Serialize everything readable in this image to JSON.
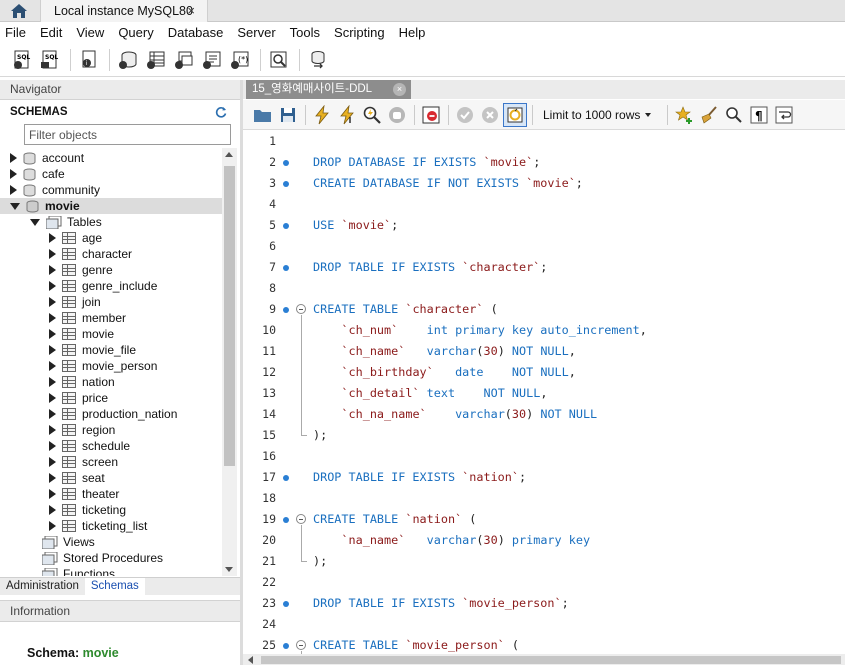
{
  "window": {
    "connection_tab": "Local instance MySQL80",
    "close_glyph": "×"
  },
  "menu": [
    "File",
    "Edit",
    "View",
    "Query",
    "Database",
    "Server",
    "Tools",
    "Scripting",
    "Help"
  ],
  "navigator": {
    "header": "Navigator",
    "schemas_title": "SCHEMAS",
    "filter_placeholder": "Filter objects",
    "schemas": [
      "account",
      "cafe",
      "community"
    ],
    "selected_schema": "movie",
    "tables_label": "Tables",
    "tables": [
      "age",
      "character",
      "genre",
      "genre_include",
      "join",
      "member",
      "movie",
      "movie_file",
      "movie_person",
      "nation",
      "price",
      "production_nation",
      "region",
      "schedule",
      "screen",
      "seat",
      "theater",
      "ticketing",
      "ticketing_list"
    ],
    "folders": [
      "Views",
      "Stored Procedures",
      "Functions"
    ],
    "tabs": [
      "Administration",
      "Schemas"
    ],
    "active_tab": "Schemas"
  },
  "information": {
    "header": "Information",
    "schema_label": "Schema:",
    "schema_value": "movie"
  },
  "editor": {
    "tab_title": "15_영화예매사이트-DDL",
    "limit_label": "Limit to 1000 rows",
    "lines": [
      {
        "n": "1",
        "dot": false,
        "fold": false,
        "tokens": []
      },
      {
        "n": "2",
        "dot": true,
        "fold": false,
        "tokens": [
          [
            "kw",
            "DROP DATABASE IF EXISTS "
          ],
          [
            "id",
            "`movie`"
          ],
          [
            "txt",
            ";"
          ]
        ]
      },
      {
        "n": "3",
        "dot": true,
        "fold": false,
        "tokens": [
          [
            "kw",
            "CREATE DATABASE IF NOT EXISTS "
          ],
          [
            "id",
            "`movie`"
          ],
          [
            "txt",
            ";"
          ]
        ]
      },
      {
        "n": "4",
        "dot": false,
        "fold": false,
        "tokens": []
      },
      {
        "n": "5",
        "dot": true,
        "fold": false,
        "tokens": [
          [
            "kw",
            "USE "
          ],
          [
            "id",
            "`movie`"
          ],
          [
            "txt",
            ";"
          ]
        ]
      },
      {
        "n": "6",
        "dot": false,
        "fold": false,
        "tokens": []
      },
      {
        "n": "7",
        "dot": true,
        "fold": false,
        "tokens": [
          [
            "kw",
            "DROP TABLE IF EXISTS "
          ],
          [
            "id",
            "`character`"
          ],
          [
            "txt",
            ";"
          ]
        ]
      },
      {
        "n": "8",
        "dot": false,
        "fold": false,
        "tokens": []
      },
      {
        "n": "9",
        "dot": true,
        "fold": true,
        "tokens": [
          [
            "kw",
            "CREATE TABLE "
          ],
          [
            "id",
            "`character`"
          ],
          [
            "txt",
            " ("
          ]
        ]
      },
      {
        "n": "10",
        "dot": false,
        "fold": false,
        "tokens": [
          [
            "txt",
            "    "
          ],
          [
            "id",
            "`ch_num`"
          ],
          [
            "txt",
            "    "
          ],
          [
            "kw",
            "int primary key auto_increment"
          ],
          [
            "txt",
            ","
          ]
        ]
      },
      {
        "n": "11",
        "dot": false,
        "fold": false,
        "tokens": [
          [
            "txt",
            "    "
          ],
          [
            "id",
            "`ch_name`"
          ],
          [
            "txt",
            "   "
          ],
          [
            "kw",
            "varchar"
          ],
          [
            "txt",
            "("
          ],
          [
            "num",
            "30"
          ],
          [
            "txt",
            ") "
          ],
          [
            "kw",
            "NOT NULL"
          ],
          [
            "txt",
            ","
          ]
        ]
      },
      {
        "n": "12",
        "dot": false,
        "fold": false,
        "tokens": [
          [
            "txt",
            "    "
          ],
          [
            "id",
            "`ch_birthday`"
          ],
          [
            "txt",
            "   "
          ],
          [
            "kw",
            "date"
          ],
          [
            "txt",
            "    "
          ],
          [
            "kw",
            "NOT NULL"
          ],
          [
            "txt",
            ","
          ]
        ]
      },
      {
        "n": "13",
        "dot": false,
        "fold": false,
        "tokens": [
          [
            "txt",
            "    "
          ],
          [
            "id",
            "`ch_detail`"
          ],
          [
            "txt",
            " "
          ],
          [
            "kw",
            "text"
          ],
          [
            "txt",
            "    "
          ],
          [
            "kw",
            "NOT NULL"
          ],
          [
            "txt",
            ","
          ]
        ]
      },
      {
        "n": "14",
        "dot": false,
        "fold": false,
        "tokens": [
          [
            "txt",
            "    "
          ],
          [
            "id",
            "`ch_na_name`"
          ],
          [
            "txt",
            "    "
          ],
          [
            "kw",
            "varchar"
          ],
          [
            "txt",
            "("
          ],
          [
            "num",
            "30"
          ],
          [
            "txt",
            ") "
          ],
          [
            "kw",
            "NOT NULL"
          ]
        ]
      },
      {
        "n": "15",
        "dot": false,
        "fold": false,
        "tokens": [
          [
            "txt",
            ");"
          ]
        ]
      },
      {
        "n": "16",
        "dot": false,
        "fold": false,
        "tokens": []
      },
      {
        "n": "17",
        "dot": true,
        "fold": false,
        "tokens": [
          [
            "kw",
            "DROP TABLE IF EXISTS "
          ],
          [
            "id",
            "`nation`"
          ],
          [
            "txt",
            ";"
          ]
        ]
      },
      {
        "n": "18",
        "dot": false,
        "fold": false,
        "tokens": []
      },
      {
        "n": "19",
        "dot": true,
        "fold": true,
        "tokens": [
          [
            "kw",
            "CREATE TABLE "
          ],
          [
            "id",
            "`nation`"
          ],
          [
            "txt",
            " ("
          ]
        ]
      },
      {
        "n": "20",
        "dot": false,
        "fold": false,
        "tokens": [
          [
            "txt",
            "    "
          ],
          [
            "id",
            "`na_name`"
          ],
          [
            "txt",
            "   "
          ],
          [
            "kw",
            "varchar"
          ],
          [
            "txt",
            "("
          ],
          [
            "num",
            "30"
          ],
          [
            "txt",
            ") "
          ],
          [
            "kw",
            "primary key"
          ]
        ]
      },
      {
        "n": "21",
        "dot": false,
        "fold": false,
        "tokens": [
          [
            "txt",
            ");"
          ]
        ]
      },
      {
        "n": "22",
        "dot": false,
        "fold": false,
        "tokens": []
      },
      {
        "n": "23",
        "dot": true,
        "fold": false,
        "tokens": [
          [
            "kw",
            "DROP TABLE IF EXISTS "
          ],
          [
            "id",
            "`movie_person`"
          ],
          [
            "txt",
            ";"
          ]
        ]
      },
      {
        "n": "24",
        "dot": false,
        "fold": false,
        "tokens": []
      },
      {
        "n": "25",
        "dot": true,
        "fold": true,
        "tokens": [
          [
            "kw",
            "CREATE TABLE "
          ],
          [
            "id",
            "`movie_person`"
          ],
          [
            "txt",
            " ("
          ]
        ]
      }
    ]
  },
  "colors": {
    "keyword": "#1a6fbf",
    "identifier": "#8b1a1a",
    "breakpoint_dot": "#2a7fd4",
    "schema_value": "#2d8a2d",
    "active_tab_text": "#1a4fb0"
  }
}
